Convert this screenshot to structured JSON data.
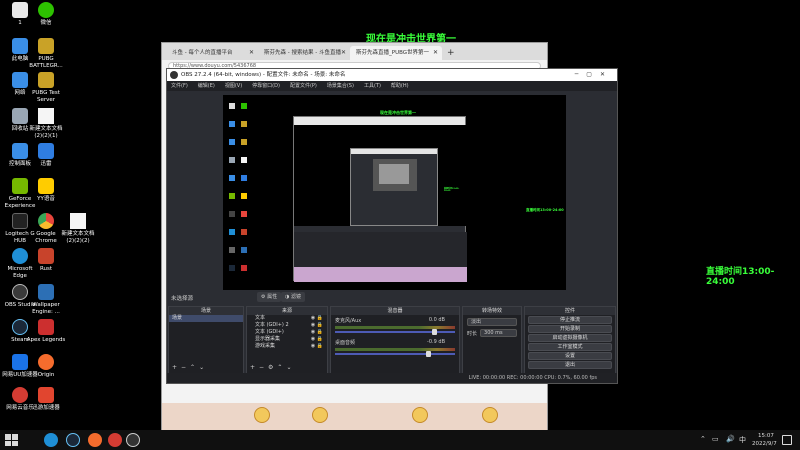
{
  "desktop": {
    "icons": [
      {
        "label": "1",
        "color": "#e8e8e8"
      },
      {
        "label": "微信",
        "color": "#2dc100"
      },
      {
        "label": "此电脑",
        "color": "#3a8ee6"
      },
      {
        "label": "PUBG BATTLEGR...",
        "color": "#c9a227"
      },
      {
        "label": "网络",
        "color": "#3a8ee6"
      },
      {
        "label": "PUBG Test Server",
        "color": "#c9a227"
      },
      {
        "label": "回收站",
        "color": "#9aa7b5"
      },
      {
        "label": "新建文本文档 (2)(2)(1)",
        "color": "#f5f5f5"
      },
      {
        "label": "控制面板",
        "color": "#3a8ee6"
      },
      {
        "label": "迅雷",
        "color": "#2f7de1"
      },
      {
        "label": "GeForce Experience",
        "color": "#76b900"
      },
      {
        "label": "YY语音",
        "color": "#ffcc00"
      },
      {
        "label": "Logitech G HUB",
        "color": "#222222"
      },
      {
        "label": "Google Chrome",
        "color": "#e8453c"
      },
      {
        "label": "新建文本文档 (2)(2)(2)",
        "color": "#f5f5f5"
      },
      {
        "label": "Microsoft Edge",
        "color": "#1f8fd6"
      },
      {
        "label": "Rust",
        "color": "#c8432b"
      },
      {
        "label": "OBS Studio",
        "color": "#3a3a3a"
      },
      {
        "label": "Wallpaper Engine: ...",
        "color": "#2c6fb5"
      },
      {
        "label": "Steam",
        "color": "#1b2838"
      },
      {
        "label": "Apex Legends",
        "color": "#cc2f2f"
      },
      {
        "label": "网易UU加速器",
        "color": "#1a73e8"
      },
      {
        "label": "Origin",
        "color": "#f56c2d"
      },
      {
        "label": "网易云音乐",
        "color": "#d43c33"
      },
      {
        "label": "迅游加速器",
        "color": "#e1452f"
      }
    ]
  },
  "overlay": {
    "title": "现在是冲击世界第一",
    "live_time": "直播时间13:00-24:00"
  },
  "browser": {
    "tabs": [
      {
        "title": "斗鱼 - 每个人的直播平台"
      },
      {
        "title": "斯芬先森 - 搜索结果 - 斗鱼直播"
      },
      {
        "title": "斯芬先森直播_PUBG世界第一"
      }
    ],
    "url": "https://www.douyu.com/5436768"
  },
  "obs": {
    "title": "OBS 27.2.4 (64-bit, windows) - 配置文件: 未命名 - 场景: 未命名",
    "menu": [
      "文件(F)",
      "编辑(E)",
      "视图(V)",
      "停靠窗口(D)",
      "配置文件(P)",
      "场景集合(S)",
      "工具(T)",
      "帮助(H)"
    ],
    "no_source_selected": "未选择源",
    "properties_label": "属性",
    "filters_label": "滤镜",
    "docks": {
      "scenes": {
        "title": "场景",
        "items": [
          "场景"
        ]
      },
      "sources": {
        "title": "来源",
        "items": [
          "文本",
          "文本 (GDI+) 2",
          "文本 (GDI+)",
          "显示器采集",
          "游戏采集"
        ]
      },
      "mixer": {
        "title": "混音器",
        "channels": [
          {
            "name": "麦克风/Aux",
            "db": "0.0 dB",
            "level": 0.85
          },
          {
            "name": "桌面音频",
            "db": "-0.9 dB",
            "level": 0.8
          }
        ]
      },
      "transitions": {
        "title": "转场特效",
        "selected": "淡出",
        "duration_label": "时长",
        "duration_value": "300 ms"
      },
      "controls": {
        "title": "控件",
        "buttons": [
          "停止推流",
          "开始录制",
          "启动虚拟摄像机",
          "工作室模式",
          "设置",
          "退出"
        ]
      }
    },
    "status": "LIVE: 00:00:00    REC: 00:00:00    CPU: 0.7%, 60.00 fps"
  },
  "taskbar": {
    "time": "15:07",
    "date": "2022/9/7",
    "ime": "中"
  }
}
